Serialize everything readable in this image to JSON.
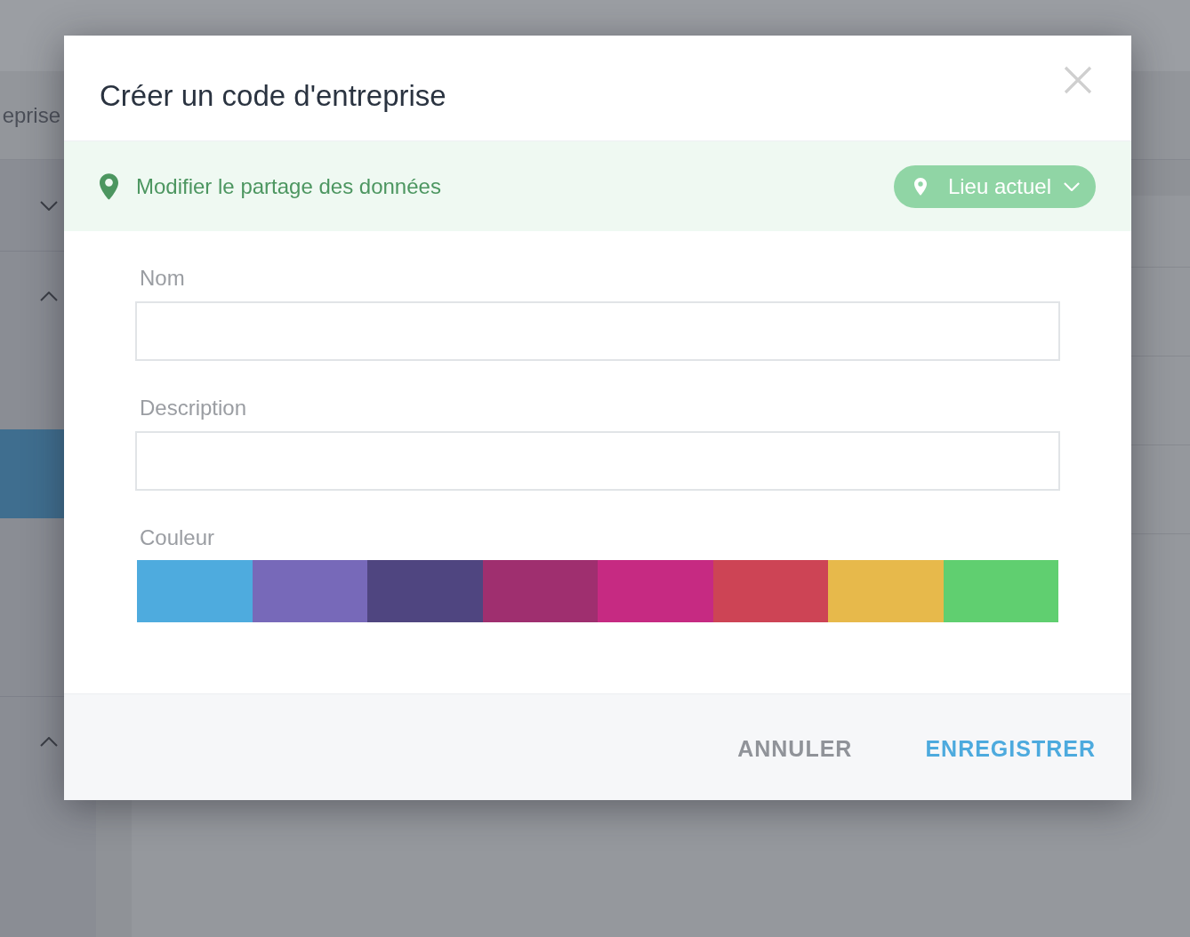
{
  "background": {
    "header_text": "eprise",
    "sidebar": {
      "items": [
        {
          "expanded": false
        },
        {
          "expanded": true,
          "children": [
            {
              "selected": false
            },
            {
              "selected": true
            },
            {
              "selected": false
            },
            {
              "selected": false
            }
          ]
        },
        {
          "expanded": true
        }
      ]
    }
  },
  "dialog": {
    "title": "Créer un code d'entreprise",
    "banner": {
      "text": "Modifier le partage des données",
      "location_button": {
        "label": "Lieu actuel"
      }
    },
    "fields": [
      {
        "label": "Nom"
      },
      {
        "label": "Description"
      }
    ],
    "color_picker": {
      "label": "Couleur",
      "swatches": [
        {
          "color": "#4eabde",
          "selected": false
        },
        {
          "color": "#7769b9",
          "selected": false
        },
        {
          "color": "#4f4580",
          "selected": false
        },
        {
          "color": "#9f2f6f",
          "selected": false
        },
        {
          "color": "#c62a82",
          "selected": false
        },
        {
          "color": "#cd4455",
          "selected": false
        },
        {
          "color": "#e7b94b",
          "selected": false
        },
        {
          "color": "#60cf70",
          "selected": false
        }
      ]
    },
    "buttons": [
      {
        "kind": "secondary",
        "label": "ANNULER"
      },
      {
        "kind": "primary",
        "label": "ENREGISTRER"
      }
    ]
  }
}
